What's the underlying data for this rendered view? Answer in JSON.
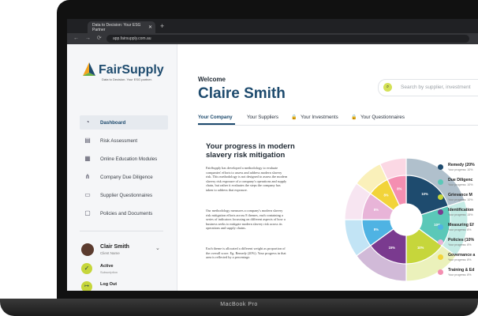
{
  "browser": {
    "tab_title": "Data to Decision: Your ESG Partner",
    "tab_close": "✕",
    "new_tab": "+",
    "nav": "← → ⟳ ⌂",
    "url": "app.fairsupply.com.au"
  },
  "device": {
    "model": "MacBook Pro"
  },
  "sidebar": {
    "logo_text": "FairSupply",
    "logo_tagline": "Data to Decision. Your ESG partner.",
    "items": [
      {
        "label": "Dashboard",
        "icon": "gauge-icon",
        "glyph": "◔"
      },
      {
        "label": "Risk Assessment",
        "icon": "table-icon",
        "glyph": "▤"
      },
      {
        "label": "Online Education Modules",
        "icon": "grid-icon",
        "glyph": "▦"
      },
      {
        "label": "Company Due Diligence",
        "icon": "org-chart-icon",
        "glyph": "⋔"
      },
      {
        "label": "Supplier Questionnaires",
        "icon": "chat-icon",
        "glyph": "▭"
      },
      {
        "label": "Policies and Documents",
        "icon": "document-icon",
        "glyph": "▢"
      }
    ],
    "user": {
      "name": "Clair Smith",
      "role": "Client Name",
      "chevron": "⌄"
    },
    "status": {
      "label": "Active",
      "sub": "Subscription",
      "glyph": "✓"
    },
    "logout": {
      "label": "Log Out",
      "glyph": "↦"
    }
  },
  "header": {
    "welcome": "Welcome",
    "name": "Claire Smith",
    "search_placeholder": "Search by supplier, investment"
  },
  "tabs": [
    {
      "label": "Your Company",
      "locked": false
    },
    {
      "label": "Your Suppliers",
      "locked": false
    },
    {
      "label": "Your Investments",
      "locked": true
    },
    {
      "label": "Your Questionnaires",
      "locked": true
    }
  ],
  "progress": {
    "title": "Your progress in modern slavery risk mitigation",
    "paragraphs": [
      "FairSupply has developed a methodology to evaluate companies' efforts to assess and address modern slavery risk. This methodology is not designed to assess the modern slavery risk exposure of a company's operations and supply chain, but rather it evaluates the steps the company has taken to address that exposure.",
      "Our methodology measures a company's modern slavery risk mitigation efforts across 8 themes, each containing a series of indicators focussing on different aspects of how a business seeks to mitigate modern slavery risk across its operations and supply chains.",
      "Each theme is allocated a different weight as proportion of the overall score. Eg. Remedy (20%). Your progress in that area is reflected by a percentage."
    ]
  },
  "chart_data": {
    "type": "pie",
    "categories": [
      "Remedy",
      "Due Diligence",
      "Grievance Mechanisms",
      "Identification",
      "Measuring Effectiveness",
      "Policies",
      "Governance",
      "Training & Education"
    ],
    "values": [
      20,
      15,
      15,
      15,
      10,
      10,
      8,
      7
    ],
    "data_labels": [
      "10%",
      "10%",
      "10%",
      "15%",
      "8%",
      "8%",
      "8%",
      "8%"
    ],
    "colors": [
      "#1e4b6e",
      "#5bc8b8",
      "#c6d63b",
      "#7a3a8f",
      "#4fb3e3",
      "#e8b4d8",
      "#f2d43a",
      "#f48fb1"
    ],
    "legend": [
      {
        "label": "Remedy (20%",
        "sub": "Your progress: 10%"
      },
      {
        "label": "Due Diligenc",
        "sub": "Your progress: 10%"
      },
      {
        "label": "Grievance M",
        "sub": "Your progress: 10%"
      },
      {
        "label": "Identification",
        "sub": "Your progress: 15%"
      },
      {
        "label": "Measuring Ef",
        "sub": "Your progress: 8%"
      },
      {
        "label": "Policies (10%",
        "sub": "Your progress: 8%"
      },
      {
        "label": "Governance a",
        "sub": "Your progress: 8%"
      },
      {
        "label": "Training & Ed",
        "sub": "Your progress: 8%"
      }
    ],
    "legend_placement": "right"
  }
}
